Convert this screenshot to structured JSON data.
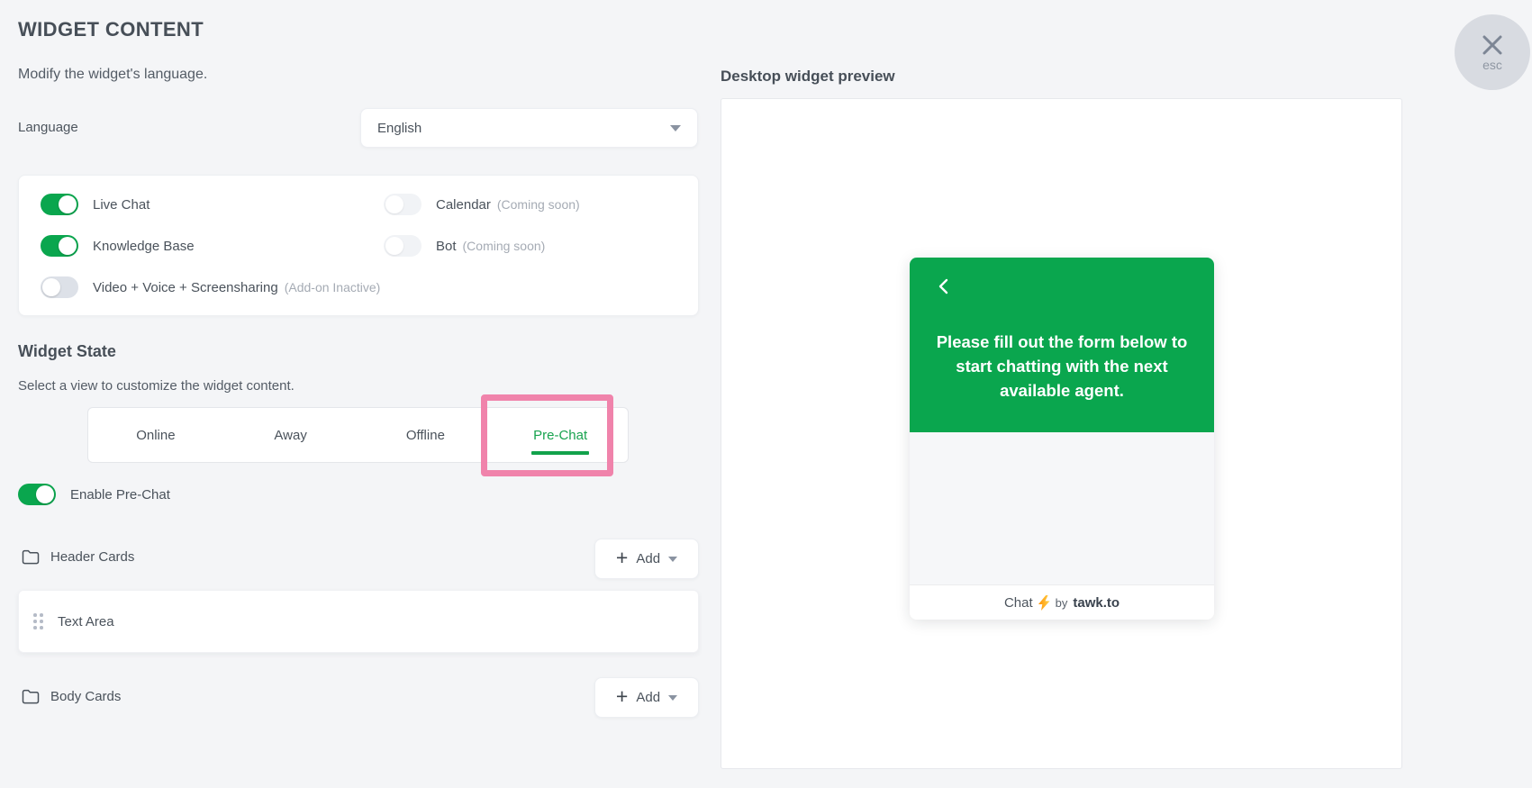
{
  "page": {
    "title": "WIDGET CONTENT",
    "subtitle": "Modify the widget's language."
  },
  "language": {
    "label": "Language",
    "selected": "English"
  },
  "features": {
    "items": [
      {
        "label": "Live Chat",
        "enabled": true,
        "note": ""
      },
      {
        "label": "Knowledge Base",
        "enabled": true,
        "note": ""
      },
      {
        "label": "Video + Voice + Screensharing",
        "enabled": false,
        "note": "(Add-on Inactive)"
      },
      {
        "label": "Calendar",
        "enabled": false,
        "note": "(Coming soon)"
      },
      {
        "label": "Bot",
        "enabled": false,
        "note": "(Coming soon)"
      }
    ]
  },
  "widget_state": {
    "title": "Widget State",
    "subtitle": "Select a view to customize the widget content.",
    "tabs": [
      {
        "label": "Online",
        "active": false
      },
      {
        "label": "Away",
        "active": false
      },
      {
        "label": "Offline",
        "active": false
      },
      {
        "label": "Pre-Chat",
        "active": true
      }
    ]
  },
  "prechat": {
    "toggle_label": "Enable Pre-Chat",
    "enabled": true
  },
  "header_cards": {
    "label": "Header Cards",
    "add_label": "Add",
    "cards": [
      {
        "label": "Text Area"
      }
    ]
  },
  "body_cards": {
    "label": "Body Cards",
    "add_label": "Add"
  },
  "preview": {
    "title": "Desktop widget preview",
    "message": "Please fill out the form below to start chatting with the next available agent.",
    "footer": {
      "chat": "Chat",
      "by": "by",
      "brand": "tawk.to"
    }
  },
  "close": {
    "esc_label": "esc"
  },
  "icons": {
    "plus": "+",
    "bolt": "lightning-bolt",
    "caret": "caret-down"
  },
  "colors": {
    "accent_green": "#0aa64e",
    "highlight_pink": "#f083ab",
    "page_bg": "#f4f5f7"
  }
}
